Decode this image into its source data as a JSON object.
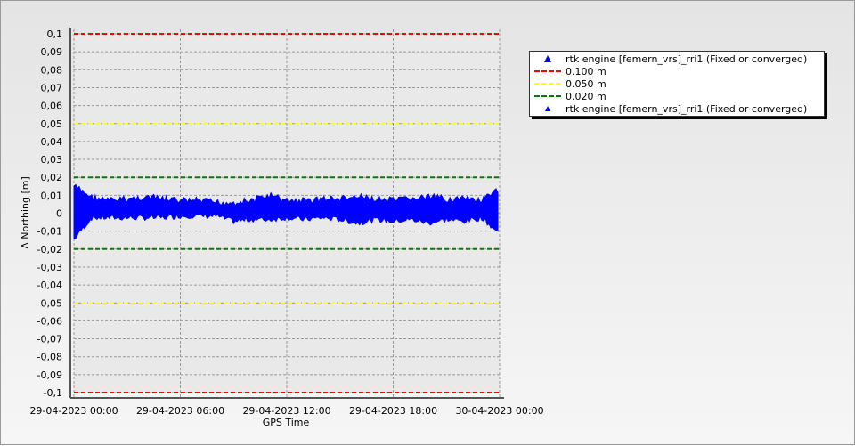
{
  "chart_data": {
    "type": "scatter",
    "xlabel": "GPS Time",
    "ylabel": "Δ Northing [m]",
    "x_ticks": [
      "29-04-2023 00:00",
      "29-04-2023 06:00",
      "29-04-2023 12:00",
      "29-04-2023 18:00",
      "30-04-2023 00:00"
    ],
    "xlim_hours": [
      0,
      24
    ],
    "y_ticks": [
      "0,1",
      "0,09",
      "0,08",
      "0,07",
      "0,06",
      "0,05",
      "0,04",
      "0,03",
      "0,02",
      "0,01",
      "0",
      "-0,01",
      "-0,02",
      "-0,03",
      "-0,04",
      "-0,05",
      "-0,06",
      "-0,07",
      "-0,08",
      "-0,09",
      "-0,1"
    ],
    "ylim": [
      -0.1,
      0.1
    ],
    "grid": true,
    "legend_position": "right",
    "thresholds": [
      {
        "name": "0.100 m",
        "value": 0.1,
        "color": "#ff0000"
      },
      {
        "name": "0.050 m",
        "value": 0.05,
        "color": "#ffff00"
      },
      {
        "name": "0.020 m",
        "value": 0.02,
        "color": "#008000"
      }
    ],
    "series": [
      {
        "name": "rtk engine [femern_vrs]_rri1 (Fixed or converged)",
        "color": "#0000ff",
        "marker": "triangle",
        "envelope_hours": [
          0,
          1,
          2,
          3,
          4,
          5,
          6,
          7,
          8,
          9,
          10,
          11,
          12,
          13,
          14,
          15,
          16,
          17,
          18,
          19,
          20,
          21,
          22,
          23,
          24
        ],
        "upper": [
          0.017,
          0.011,
          0.009,
          0.01,
          0.011,
          0.01,
          0.009,
          0.009,
          0.008,
          0.008,
          0.009,
          0.012,
          0.009,
          0.009,
          0.01,
          0.01,
          0.011,
          0.01,
          0.009,
          0.01,
          0.011,
          0.01,
          0.01,
          0.009,
          0.015
        ],
        "lower": [
          -0.016,
          -0.004,
          -0.004,
          -0.004,
          -0.004,
          -0.004,
          -0.003,
          -0.003,
          -0.003,
          -0.006,
          -0.005,
          -0.005,
          -0.004,
          -0.005,
          -0.004,
          -0.005,
          -0.007,
          -0.005,
          -0.006,
          -0.005,
          -0.007,
          -0.005,
          -0.006,
          -0.004,
          -0.013
        ]
      }
    ],
    "legend": [
      "rtk engine [femern_vrs]_rri1 (Fixed or converged)",
      "0.100 m",
      "0.050 m",
      "0.020 m",
      "rtk engine [femern_vrs]_rri1 (Fixed or converged)"
    ]
  }
}
